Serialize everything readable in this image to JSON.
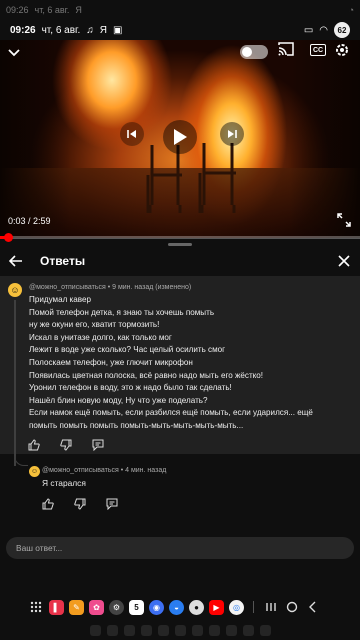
{
  "ghost_status": {
    "time": "09:26",
    "date": "чт, 6 авг.",
    "carrier": "Я"
  },
  "status": {
    "time": "09:26",
    "date": "чт, 6 авг.",
    "carrier": "Я",
    "battery": "62"
  },
  "video": {
    "current_time": "0:03",
    "duration": "2:59",
    "progress": 0.017,
    "cc_label": "CC",
    "colors": {
      "progress": "#ff0000"
    }
  },
  "panel": {
    "title": "Ответы"
  },
  "comment": {
    "meta": "@можно_отписываться • 9 мин. назад (изменено)",
    "lines": [
      "Придумал кавер",
      "Помой телефон детка, я знаю ты хочешь помыть",
      "ну же окуни его, хватит тормозить!",
      "Искал в унитазе долго, как только мог",
      "Лежит в воде уже сколько? Час целый осилить смог",
      "Полоскаем телефон, уже глючит микрофон",
      "Появилась цветная полоска, всё равно надо мыть его жёстко!",
      "Уронил телефон в воду, это ж надо было так сделать!",
      "Нашёл блин новую моду, Ну что уже поделать?",
      "Если намок ещё помыть, если разбился ещё помыть, если ударился... ещё",
      "помыть помыть помыть помыть-мыть-мыть-мыть-мыть..."
    ]
  },
  "reply": {
    "meta": "@можно_отписываться • 4 мин. назад",
    "text": "Я старался"
  },
  "answer_box": {
    "placeholder": "Ваш ответ..."
  },
  "dock": {
    "badge_app": "5"
  }
}
